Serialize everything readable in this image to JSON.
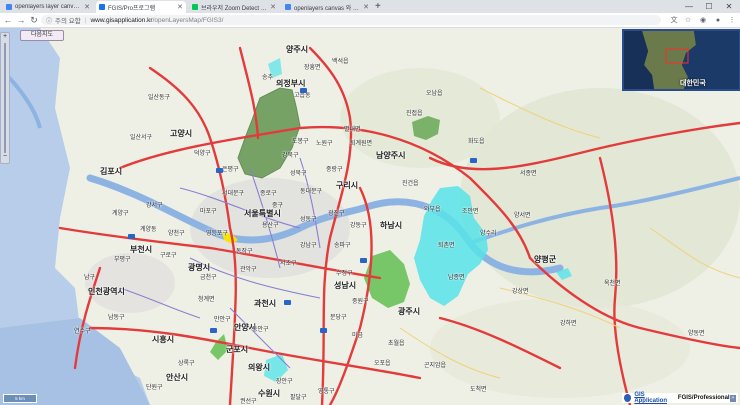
{
  "browser": {
    "tabs": [
      {
        "label": "openlayers layer canvas image",
        "active": false,
        "favicon_color": "#4285f4"
      },
      {
        "label": "FGIS/Pro프로그램",
        "active": true,
        "favicon_color": "#1a73e8"
      },
      {
        "label": "브라우저 Zoom Detect : 네이버",
        "active": false,
        "favicon_color": "#03c75a"
      },
      {
        "label": "openlayers canvas 와 browser",
        "active": false,
        "favicon_color": "#4285f4"
      }
    ],
    "new_tab": "+",
    "window_controls": {
      "minimize": "—",
      "maximize": "☐",
      "close": "✕"
    },
    "address": {
      "security_label": "주의 요함",
      "host": "www.gisapplication.kr",
      "path": "/openLayersMap/FGIS3/"
    }
  },
  "map": {
    "basemap_button": "다음지도",
    "scale_label": "5 km",
    "overview_label": "대한민국",
    "brand": {
      "name": "GIS Application",
      "product": "FGIS/Professional",
      "collapse": "»"
    },
    "cities": [
      {
        "name": "양주시",
        "size": "big"
      },
      {
        "name": "의정부시",
        "size": "big"
      },
      {
        "name": "남양주시",
        "size": "big"
      },
      {
        "name": "서울특별시",
        "size": "big"
      },
      {
        "name": "구리시",
        "size": "big"
      },
      {
        "name": "하남시",
        "size": "big"
      },
      {
        "name": "김포시",
        "size": "big"
      },
      {
        "name": "부천시",
        "size": "big"
      },
      {
        "name": "인천광역시",
        "size": "big"
      },
      {
        "name": "광명시",
        "size": "big"
      },
      {
        "name": "과천시",
        "size": "big"
      },
      {
        "name": "성남시",
        "size": "big"
      },
      {
        "name": "광주시",
        "size": "big"
      },
      {
        "name": "안양시",
        "size": "big"
      },
      {
        "name": "군포시",
        "size": "big"
      },
      {
        "name": "시흥시",
        "size": "big"
      },
      {
        "name": "안산시",
        "size": "big"
      },
      {
        "name": "의왕시",
        "size": "big"
      },
      {
        "name": "수원시",
        "size": "big"
      },
      {
        "name": "양평군",
        "size": "big"
      },
      {
        "name": "고양시",
        "size": "big"
      }
    ],
    "districts": [
      "일산동구",
      "덕양구",
      "일산서구",
      "도봉구",
      "노원구",
      "강북구",
      "은평구",
      "성북구",
      "중랑구",
      "서대문구",
      "종로구",
      "동대문구",
      "마포구",
      "중구",
      "광진구",
      "용산구",
      "성동구",
      "강서구",
      "양천구",
      "영등포구",
      "동작구",
      "구로구",
      "금천구",
      "관악구",
      "서초구",
      "강남구",
      "송파구",
      "강동구",
      "계양구",
      "부평구",
      "남동구",
      "연수구",
      "남구",
      "중원구",
      "수정구",
      "분당구",
      "만안구",
      "동안구",
      "상록구",
      "단원구",
      "장안구",
      "권선구",
      "팔달구",
      "영통구",
      "미금",
      "오남읍",
      "화도읍",
      "진접읍",
      "퇴계원면",
      "조안면",
      "양서면",
      "양수리",
      "퇴촌면",
      "남종면",
      "초월읍",
      "곤지암읍",
      "오포읍",
      "도척면",
      "청계면",
      "백석읍",
      "장흥면",
      "별내면",
      "진건읍",
      "와부읍",
      "서종면",
      "옥천면",
      "양동면",
      "강하면",
      "강상면",
      "고읍동",
      "송추",
      "계양동"
    ]
  }
}
